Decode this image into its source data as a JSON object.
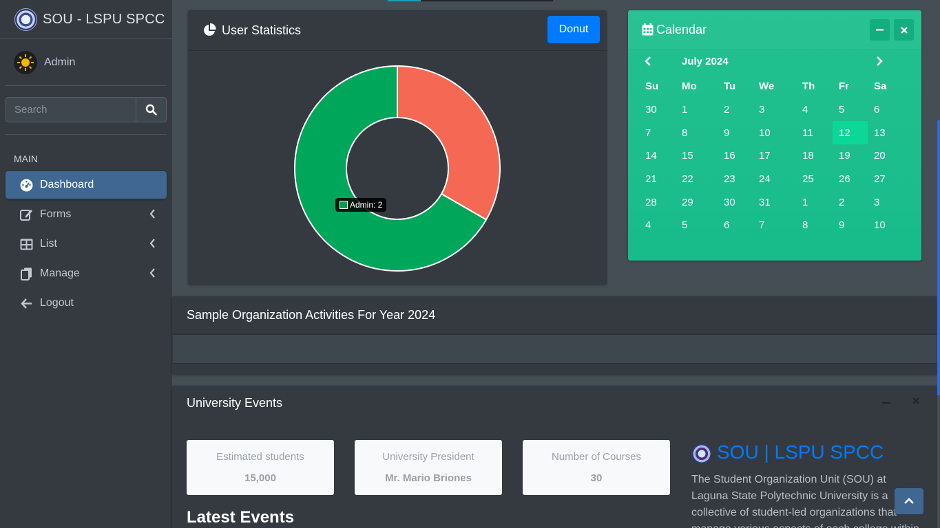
{
  "sidebar": {
    "brand": "SOU - LSPU SPCC",
    "user": "Admin",
    "search_placeholder": "Search",
    "header": "MAIN",
    "items": [
      {
        "label": "Dashboard",
        "icon": "tachometer-icon",
        "active": true
      },
      {
        "label": "Forms",
        "icon": "edit-icon"
      },
      {
        "label": "List",
        "icon": "table-icon"
      },
      {
        "label": "Manage",
        "icon": "copy-icon"
      },
      {
        "label": "Logout",
        "icon": "arrow-left-icon"
      }
    ]
  },
  "stats_card": {
    "title": "User Statistics",
    "button": "Donut",
    "tooltip": "Admin: 2"
  },
  "chart_data": {
    "type": "pie",
    "title": "",
    "labels": [
      "",
      "Admin"
    ],
    "values": [
      1,
      2
    ],
    "colors": [
      "#f56954",
      "#00a65a"
    ]
  },
  "calendar": {
    "title": "Calendar",
    "month": "July 2024",
    "days": [
      "Su",
      "Mo",
      "Tu",
      "We",
      "Th",
      "Fr",
      "Sa"
    ],
    "weeks": [
      [
        "30",
        "1",
        "2",
        "3",
        "4",
        "5",
        "6"
      ],
      [
        "7",
        "8",
        "9",
        "10",
        "11",
        "12",
        "13"
      ],
      [
        "14",
        "15",
        "16",
        "17",
        "18",
        "19",
        "20"
      ],
      [
        "21",
        "22",
        "23",
        "24",
        "25",
        "26",
        "27"
      ],
      [
        "28",
        "29",
        "30",
        "31",
        "1",
        "2",
        "3"
      ],
      [
        "4",
        "5",
        "6",
        "7",
        "8",
        "9",
        "10"
      ]
    ],
    "today": "12"
  },
  "activities": {
    "title": "Sample Organization Activities For Year 2024"
  },
  "events": {
    "title": "University Events",
    "stats": [
      {
        "label": "Estimated students",
        "value": "15,000"
      },
      {
        "label": "University President",
        "value": "Mr. Mario Briones"
      },
      {
        "label": "Number of Courses",
        "value": "30"
      }
    ],
    "latest": "Latest Events",
    "sou_title": "SOU | LSPU SPCC",
    "sou_desc": "The Student Organization Unit (SOU) at Laguna State Polytechnic University is a collective of student-led organizations that manage various aspects of each college within the university."
  },
  "colors": {
    "accent": "#007bff",
    "sidebar_active": "#3f6791",
    "calendar": "#1fbf8d"
  }
}
